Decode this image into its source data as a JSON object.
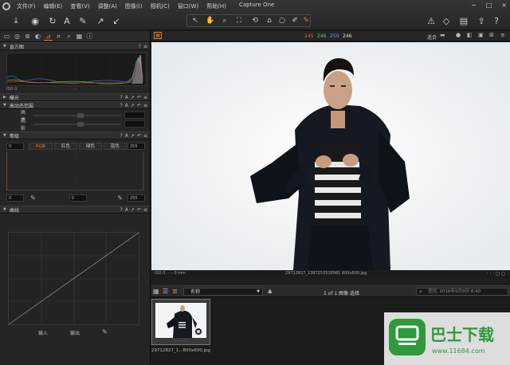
{
  "app": {
    "title": "Capture One"
  },
  "menu": [
    "文件(F)",
    "编辑(E)",
    "查看(V)",
    "调整(A)",
    "图像(I)",
    "相机(C)",
    "窗口(W)",
    "帮助(H)"
  ],
  "window_controls": [
    "−",
    "□",
    "×"
  ],
  "left_panel": {
    "histogram": {
      "title": "直方图",
      "iso_text": "ISO 0"
    },
    "exposure": {
      "title": "曝光"
    },
    "hdr": {
      "title": "高动态范围",
      "rows": [
        "高亮",
        "阴影"
      ]
    },
    "levels": {
      "title": "等级",
      "input_low": "0",
      "input_high": "255",
      "output_low": "0",
      "output_mid": "0",
      "output_high": "255",
      "channels": [
        "RGB",
        "红色",
        "绿色",
        "蓝色"
      ]
    },
    "curve": {
      "title": "曲线",
      "input_label": "输入",
      "output_label": "输出"
    },
    "section_ctrls": [
      "?",
      "A",
      "↗",
      "↶",
      "≡"
    ]
  },
  "viewbar": {
    "readouts": [
      "245",
      "246",
      "250",
      "246"
    ],
    "readout_colors": [
      "#ff5a3a",
      "#5ad05a",
      "#5a8aff",
      "#e0e0e0"
    ],
    "fit_label": "适合"
  },
  "infobar": {
    "left": "ISO 0 ·· ·· 0 mm",
    "center": "29712827_1387253518981 800x600.jpg"
  },
  "browsebar": {
    "sort_label": "名称",
    "count_text": "1 of 1 图像 选择",
    "search_placeholder": "查找, 2016年9月8日 8:40"
  },
  "thumbnail": {
    "caption": "29712827_1...800x600.jpg"
  },
  "watermark": {
    "title": "巴士下载",
    "url": "www.11684.com"
  }
}
